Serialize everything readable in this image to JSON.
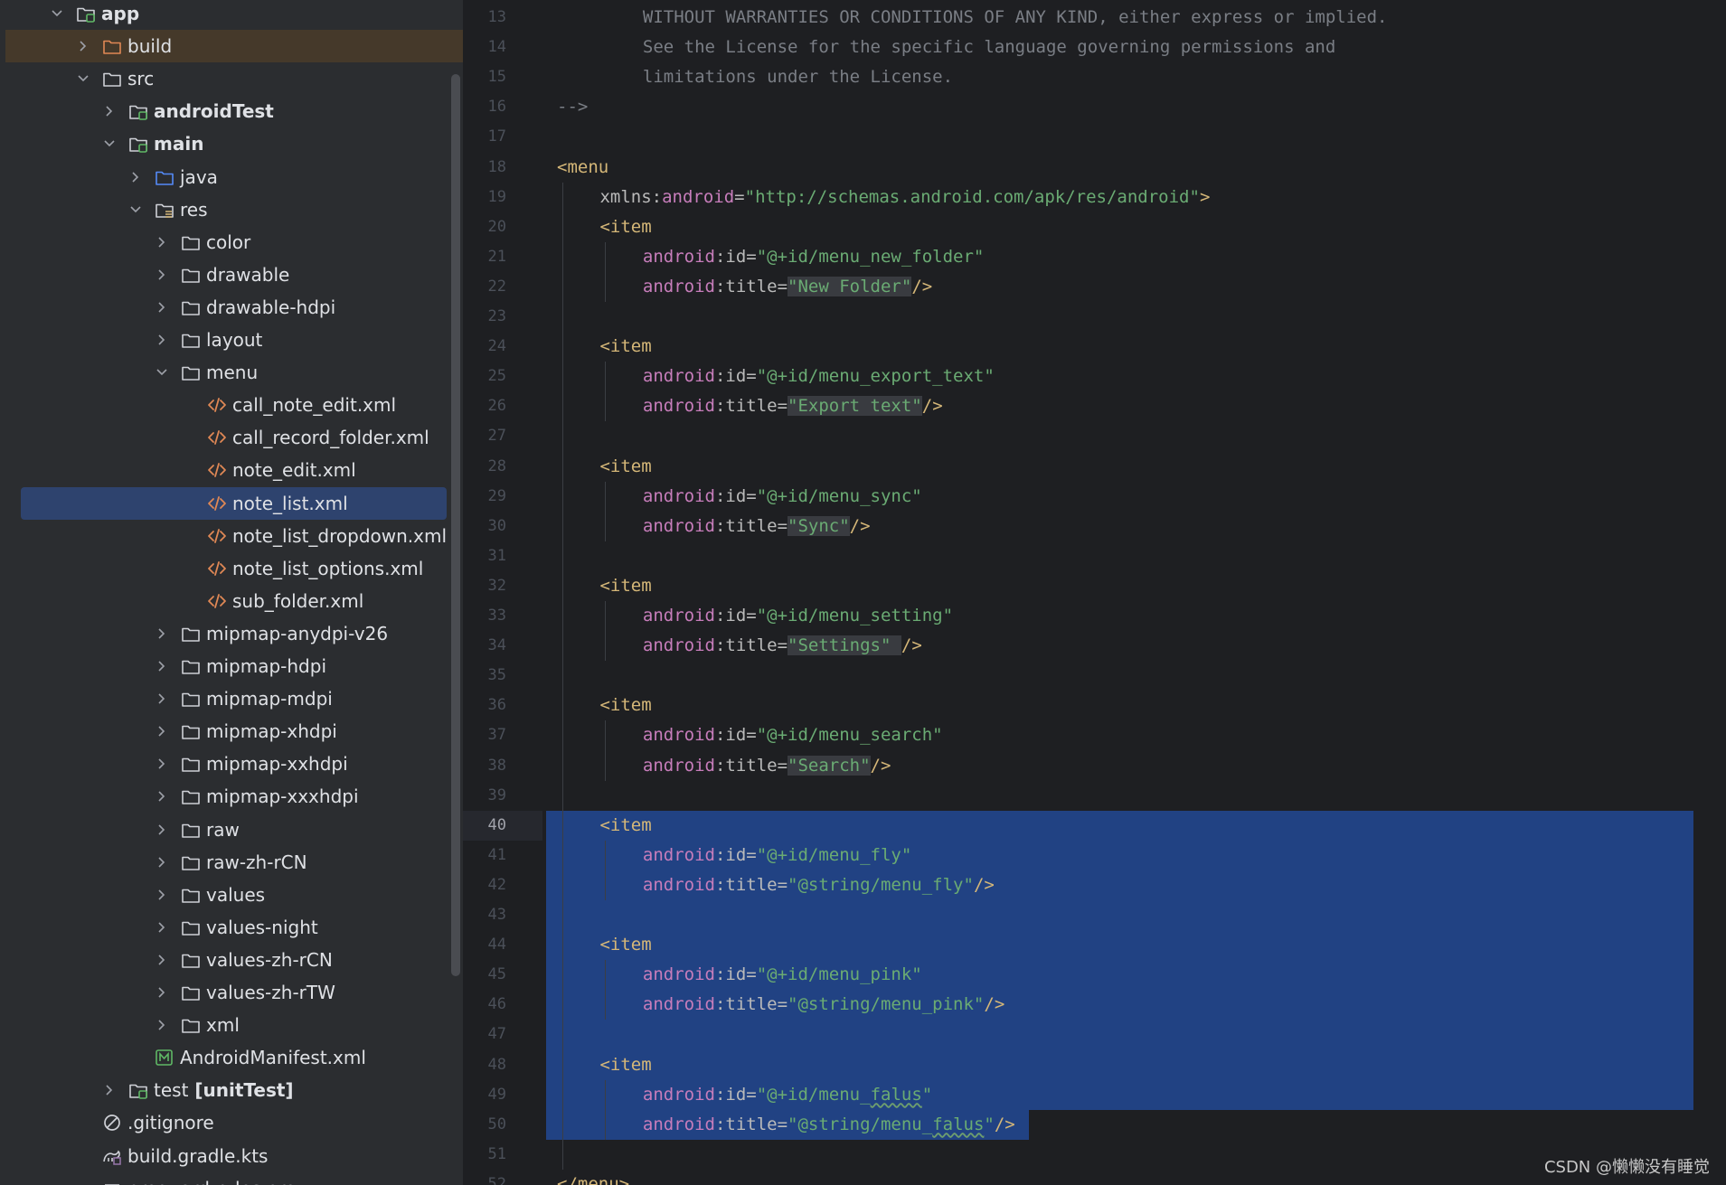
{
  "project_tree": {
    "items": [
      {
        "label": "app",
        "indent": 0,
        "expanded": true,
        "icon": "module-folder-icon",
        "bold": true,
        "highlight": ""
      },
      {
        "label": "build",
        "indent": 1,
        "expanded": false,
        "icon": "excluded-folder-icon",
        "bold": false,
        "highlight": "build"
      },
      {
        "label": "src",
        "indent": 1,
        "expanded": true,
        "icon": "folder-icon",
        "bold": false,
        "highlight": ""
      },
      {
        "label": "androidTest",
        "indent": 2,
        "expanded": false,
        "icon": "source-set-folder-icon",
        "bold": true,
        "highlight": ""
      },
      {
        "label": "main",
        "indent": 2,
        "expanded": true,
        "icon": "source-set-folder-icon",
        "bold": true,
        "highlight": ""
      },
      {
        "label": "java",
        "indent": 3,
        "expanded": false,
        "icon": "source-root-folder-icon",
        "bold": false,
        "highlight": ""
      },
      {
        "label": "res",
        "indent": 3,
        "expanded": true,
        "icon": "resource-root-folder-icon",
        "bold": false,
        "highlight": ""
      },
      {
        "label": "color",
        "indent": 4,
        "expanded": false,
        "icon": "folder-icon",
        "bold": false,
        "highlight": ""
      },
      {
        "label": "drawable",
        "indent": 4,
        "expanded": false,
        "icon": "folder-icon",
        "bold": false,
        "highlight": ""
      },
      {
        "label": "drawable-hdpi",
        "indent": 4,
        "expanded": false,
        "icon": "folder-icon",
        "bold": false,
        "highlight": ""
      },
      {
        "label": "layout",
        "indent": 4,
        "expanded": false,
        "icon": "folder-icon",
        "bold": false,
        "highlight": ""
      },
      {
        "label": "menu",
        "indent": 4,
        "expanded": true,
        "icon": "folder-icon",
        "bold": false,
        "highlight": ""
      },
      {
        "label": "call_note_edit.xml",
        "indent": 5,
        "expanded": null,
        "icon": "xml-file-icon",
        "bold": false,
        "highlight": ""
      },
      {
        "label": "call_record_folder.xml",
        "indent": 5,
        "expanded": null,
        "icon": "xml-file-icon",
        "bold": false,
        "highlight": ""
      },
      {
        "label": "note_edit.xml",
        "indent": 5,
        "expanded": null,
        "icon": "xml-file-icon",
        "bold": false,
        "highlight": ""
      },
      {
        "label": "note_list.xml",
        "indent": 5,
        "expanded": null,
        "icon": "xml-file-icon",
        "bold": false,
        "highlight": "selected"
      },
      {
        "label": "note_list_dropdown.xml",
        "indent": 5,
        "expanded": null,
        "icon": "xml-file-icon",
        "bold": false,
        "highlight": ""
      },
      {
        "label": "note_list_options.xml",
        "indent": 5,
        "expanded": null,
        "icon": "xml-file-icon",
        "bold": false,
        "highlight": ""
      },
      {
        "label": "sub_folder.xml",
        "indent": 5,
        "expanded": null,
        "icon": "xml-file-icon",
        "bold": false,
        "highlight": ""
      },
      {
        "label": "mipmap-anydpi-v26",
        "indent": 4,
        "expanded": false,
        "icon": "folder-icon",
        "bold": false,
        "highlight": ""
      },
      {
        "label": "mipmap-hdpi",
        "indent": 4,
        "expanded": false,
        "icon": "folder-icon",
        "bold": false,
        "highlight": ""
      },
      {
        "label": "mipmap-mdpi",
        "indent": 4,
        "expanded": false,
        "icon": "folder-icon",
        "bold": false,
        "highlight": ""
      },
      {
        "label": "mipmap-xhdpi",
        "indent": 4,
        "expanded": false,
        "icon": "folder-icon",
        "bold": false,
        "highlight": ""
      },
      {
        "label": "mipmap-xxhdpi",
        "indent": 4,
        "expanded": false,
        "icon": "folder-icon",
        "bold": false,
        "highlight": ""
      },
      {
        "label": "mipmap-xxxhdpi",
        "indent": 4,
        "expanded": false,
        "icon": "folder-icon",
        "bold": false,
        "highlight": ""
      },
      {
        "label": "raw",
        "indent": 4,
        "expanded": false,
        "icon": "folder-icon",
        "bold": false,
        "highlight": ""
      },
      {
        "label": "raw-zh-rCN",
        "indent": 4,
        "expanded": false,
        "icon": "folder-icon",
        "bold": false,
        "highlight": ""
      },
      {
        "label": "values",
        "indent": 4,
        "expanded": false,
        "icon": "folder-icon",
        "bold": false,
        "highlight": ""
      },
      {
        "label": "values-night",
        "indent": 4,
        "expanded": false,
        "icon": "folder-icon",
        "bold": false,
        "highlight": ""
      },
      {
        "label": "values-zh-rCN",
        "indent": 4,
        "expanded": false,
        "icon": "folder-icon",
        "bold": false,
        "highlight": ""
      },
      {
        "label": "values-zh-rTW",
        "indent": 4,
        "expanded": false,
        "icon": "folder-icon",
        "bold": false,
        "highlight": ""
      },
      {
        "label": "xml",
        "indent": 4,
        "expanded": false,
        "icon": "folder-icon",
        "bold": false,
        "highlight": ""
      },
      {
        "label": "AndroidManifest.xml",
        "indent": 3,
        "expanded": null,
        "icon": "manifest-file-icon",
        "bold": false,
        "highlight": ""
      },
      {
        "label": "test",
        "suffix": " [unitTest]",
        "indent": 2,
        "expanded": false,
        "icon": "source-set-folder-icon",
        "bold": false,
        "highlight": ""
      },
      {
        "label": ".gitignore",
        "indent": 1,
        "expanded": null,
        "icon": "gitignore-icon",
        "bold": false,
        "highlight": ""
      },
      {
        "label": "build.gradle.kts",
        "indent": 1,
        "expanded": null,
        "icon": "gradle-icon",
        "bold": false,
        "highlight": ""
      },
      {
        "label": "proguard-rules.pro",
        "indent": 1,
        "expanded": null,
        "icon": "text-file-icon",
        "bold": false,
        "highlight": ""
      }
    ]
  },
  "editor": {
    "current_line": 40,
    "inspection_status": "no-problems-check-icon",
    "lines": [
      {
        "n": 13,
        "indent": 2,
        "tokens": [
          {
            "t": "WITHOUT WARRANTIES OR CONDITIONS OF ANY KIND, either express or implied.",
            "c": "cmt"
          }
        ]
      },
      {
        "n": 14,
        "indent": 2,
        "tokens": [
          {
            "t": "See the License for the specific language governing permissions and",
            "c": "cmt"
          }
        ]
      },
      {
        "n": 15,
        "indent": 2,
        "tokens": [
          {
            "t": "limitations under the License.",
            "c": "cmt"
          }
        ]
      },
      {
        "n": 16,
        "indent": 0,
        "tokens": [
          {
            "t": "-->",
            "c": "cmt"
          }
        ]
      },
      {
        "n": 17,
        "indent": 0,
        "tokens": []
      },
      {
        "n": 18,
        "indent": 0,
        "tokens": [
          {
            "t": "<menu",
            "c": "tag"
          }
        ]
      },
      {
        "n": 19,
        "indent": 1,
        "tokens": [
          {
            "t": "xmlns",
            "c": "attr"
          },
          {
            "t": ":",
            "c": "attr"
          },
          {
            "t": "android",
            "c": "ns"
          },
          {
            "t": "=",
            "c": "attr"
          },
          {
            "t": "\"http://schemas.android.com/apk/res/android\"",
            "c": "str"
          },
          {
            "t": ">",
            "c": "tag"
          }
        ]
      },
      {
        "n": 20,
        "indent": 1,
        "tokens": [
          {
            "t": "<item",
            "c": "tag"
          }
        ]
      },
      {
        "n": 21,
        "indent": 2,
        "tokens": [
          {
            "t": "android",
            "c": "ns"
          },
          {
            "t": ":id=",
            "c": "attr"
          },
          {
            "t": "\"@+id/menu_new_folder\"",
            "c": "str"
          }
        ]
      },
      {
        "n": 22,
        "indent": 2,
        "tokens": [
          {
            "t": "android",
            "c": "ns"
          },
          {
            "t": ":title=",
            "c": "attr"
          },
          {
            "t": "\"New Folder\"",
            "c": "str strbg"
          },
          {
            "t": "/>",
            "c": "tag"
          }
        ]
      },
      {
        "n": 23,
        "indent": 0,
        "tokens": []
      },
      {
        "n": 24,
        "indent": 1,
        "tokens": [
          {
            "t": "<item",
            "c": "tag"
          }
        ]
      },
      {
        "n": 25,
        "indent": 2,
        "tokens": [
          {
            "t": "android",
            "c": "ns"
          },
          {
            "t": ":id=",
            "c": "attr"
          },
          {
            "t": "\"@+id/menu_export_text\"",
            "c": "str"
          }
        ]
      },
      {
        "n": 26,
        "indent": 2,
        "tokens": [
          {
            "t": "android",
            "c": "ns"
          },
          {
            "t": ":title=",
            "c": "attr"
          },
          {
            "t": "\"Export text\"",
            "c": "str strbg"
          },
          {
            "t": "/>",
            "c": "tag"
          }
        ]
      },
      {
        "n": 27,
        "indent": 0,
        "tokens": []
      },
      {
        "n": 28,
        "indent": 1,
        "tokens": [
          {
            "t": "<item",
            "c": "tag"
          }
        ]
      },
      {
        "n": 29,
        "indent": 2,
        "tokens": [
          {
            "t": "android",
            "c": "ns"
          },
          {
            "t": ":id=",
            "c": "attr"
          },
          {
            "t": "\"@+id/menu_sync\"",
            "c": "str"
          }
        ]
      },
      {
        "n": 30,
        "indent": 2,
        "tokens": [
          {
            "t": "android",
            "c": "ns"
          },
          {
            "t": ":title=",
            "c": "attr"
          },
          {
            "t": "\"Sync\"",
            "c": "str strbg"
          },
          {
            "t": "/>",
            "c": "tag"
          }
        ]
      },
      {
        "n": 31,
        "indent": 0,
        "tokens": []
      },
      {
        "n": 32,
        "indent": 1,
        "tokens": [
          {
            "t": "<item",
            "c": "tag"
          }
        ]
      },
      {
        "n": 33,
        "indent": 2,
        "tokens": [
          {
            "t": "android",
            "c": "ns"
          },
          {
            "t": ":id=",
            "c": "attr"
          },
          {
            "t": "\"@+id/menu_setting\"",
            "c": "str"
          }
        ]
      },
      {
        "n": 34,
        "indent": 2,
        "tokens": [
          {
            "t": "android",
            "c": "ns"
          },
          {
            "t": ":title=",
            "c": "attr"
          },
          {
            "t": "\"Settings\"",
            "c": "str strbg"
          },
          {
            "t": " ",
            "c": "attr strbg"
          },
          {
            "t": "/>",
            "c": "tag"
          }
        ]
      },
      {
        "n": 35,
        "indent": 0,
        "tokens": []
      },
      {
        "n": 36,
        "indent": 1,
        "tokens": [
          {
            "t": "<item",
            "c": "tag"
          }
        ]
      },
      {
        "n": 37,
        "indent": 2,
        "tokens": [
          {
            "t": "android",
            "c": "ns"
          },
          {
            "t": ":id=",
            "c": "attr"
          },
          {
            "t": "\"@+id/menu_search\"",
            "c": "str"
          }
        ]
      },
      {
        "n": 38,
        "indent": 2,
        "tokens": [
          {
            "t": "android",
            "c": "ns"
          },
          {
            "t": ":title=",
            "c": "attr"
          },
          {
            "t": "\"Search\"",
            "c": "str strbg"
          },
          {
            "t": "/>",
            "c": "tag"
          }
        ]
      },
      {
        "n": 39,
        "indent": 0,
        "tokens": []
      },
      {
        "n": 40,
        "indent": 1,
        "tokens": [
          {
            "t": "<item",
            "c": "tag"
          }
        ]
      },
      {
        "n": 41,
        "indent": 2,
        "tokens": [
          {
            "t": "android",
            "c": "ns"
          },
          {
            "t": ":id=",
            "c": "attr"
          },
          {
            "t": "\"@+id/menu_fly\"",
            "c": "str"
          }
        ]
      },
      {
        "n": 42,
        "indent": 2,
        "tokens": [
          {
            "t": "android",
            "c": "ns"
          },
          {
            "t": ":title=",
            "c": "attr"
          },
          {
            "t": "\"@string/menu_fly\"",
            "c": "str"
          },
          {
            "t": "/>",
            "c": "tag"
          }
        ]
      },
      {
        "n": 43,
        "indent": 0,
        "tokens": []
      },
      {
        "n": 44,
        "indent": 1,
        "tokens": [
          {
            "t": "<item",
            "c": "tag"
          }
        ]
      },
      {
        "n": 45,
        "indent": 2,
        "tokens": [
          {
            "t": "android",
            "c": "ns"
          },
          {
            "t": ":id=",
            "c": "attr"
          },
          {
            "t": "\"@+id/menu_pink\"",
            "c": "str"
          }
        ]
      },
      {
        "n": 46,
        "indent": 2,
        "tokens": [
          {
            "t": "android",
            "c": "ns"
          },
          {
            "t": ":title=",
            "c": "attr"
          },
          {
            "t": "\"@string/menu_pink\"",
            "c": "str"
          },
          {
            "t": "/>",
            "c": "tag"
          }
        ]
      },
      {
        "n": 47,
        "indent": 0,
        "tokens": []
      },
      {
        "n": 48,
        "indent": 1,
        "tokens": [
          {
            "t": "<item",
            "c": "tag"
          }
        ]
      },
      {
        "n": 49,
        "indent": 2,
        "tokens": [
          {
            "t": "android",
            "c": "ns"
          },
          {
            "t": ":id=",
            "c": "attr"
          },
          {
            "t": "\"@+id/menu_",
            "c": "str"
          },
          {
            "t": "falus",
            "c": "str wavy"
          },
          {
            "t": "\"",
            "c": "str"
          }
        ]
      },
      {
        "n": 50,
        "indent": 2,
        "tokens": [
          {
            "t": "android",
            "c": "ns"
          },
          {
            "t": ":title=",
            "c": "attr"
          },
          {
            "t": "\"@string/menu_",
            "c": "str"
          },
          {
            "t": "falus",
            "c": "str wavy"
          },
          {
            "t": "\"",
            "c": "str"
          },
          {
            "t": "/>",
            "c": "tag"
          }
        ]
      },
      {
        "n": 51,
        "indent": 0,
        "tokens": []
      },
      {
        "n": 52,
        "indent": 0,
        "tokens": [
          {
            "t": "</menu>",
            "c": "tag"
          }
        ]
      }
    ]
  },
  "watermark": "CSDN @懒懒没有睡觉",
  "colors": {
    "selection": "#214283",
    "tree_selection": "#2e436e",
    "tag": "#d5b778",
    "namespace": "#c77dbb",
    "string": "#6aab73",
    "comment": "#7a7e85",
    "check": "#5fb865"
  }
}
